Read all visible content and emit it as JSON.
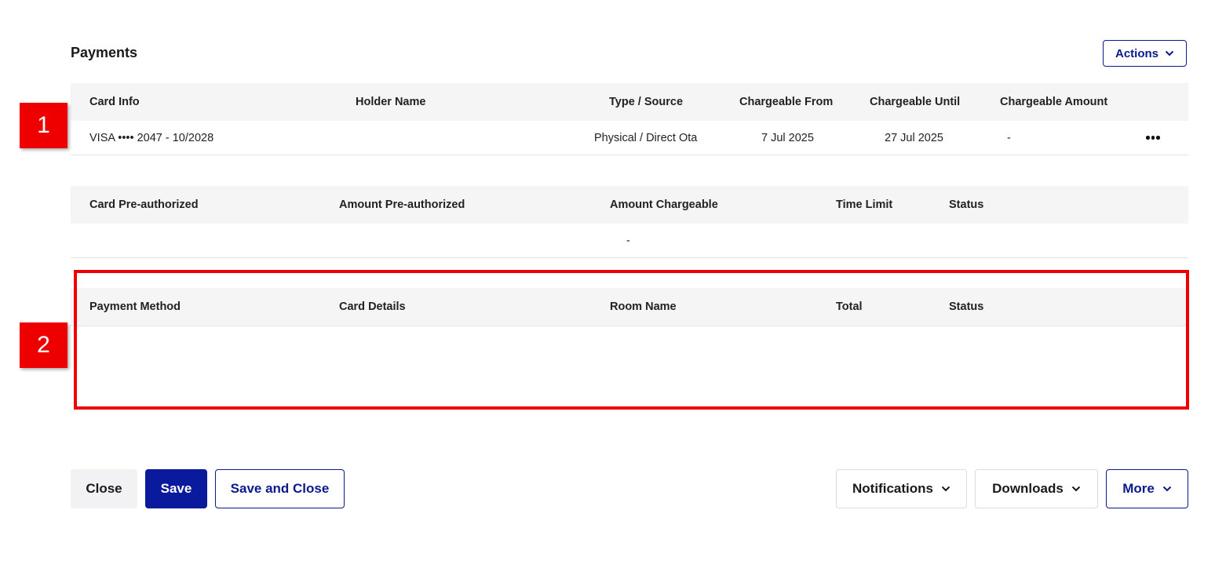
{
  "section": {
    "title": "Payments",
    "actions_label": "Actions"
  },
  "cards_table": {
    "headers": [
      "Card Info",
      "Holder Name",
      "Type / Source",
      "Chargeable From",
      "Chargeable Until",
      "Chargeable Amount"
    ],
    "rows": [
      {
        "card_info": "VISA •••• 2047 - 10/2028",
        "holder_name": "",
        "type_source": "Physical / Direct Ota",
        "chargeable_from": "7 Jul 2025",
        "chargeable_until": "27 Jul 2025",
        "chargeable_amount": "-"
      }
    ]
  },
  "preauth_table": {
    "headers": [
      "Card Pre-authorized",
      "Amount Pre-authorized",
      "Amount Chargeable",
      "Time Limit",
      "Status"
    ],
    "rows": [
      {
        "amount_chargeable": "-"
      }
    ]
  },
  "payments_table": {
    "headers": [
      "Payment Method",
      "Card Details",
      "Room Name",
      "Total",
      "Status"
    ],
    "rows": []
  },
  "markers": [
    "1",
    "2"
  ],
  "footer": {
    "close_label": "Close",
    "save_label": "Save",
    "save_close_label": "Save and Close",
    "notifications_label": "Notifications",
    "downloads_label": "Downloads",
    "more_label": "More"
  },
  "colors": {
    "brand": "#0a1a9c",
    "header_bg": "#f5f5f5",
    "marker": "#ef0000"
  },
  "icons": [
    "chevron-down-icon",
    "more-horizontal-icon"
  ]
}
